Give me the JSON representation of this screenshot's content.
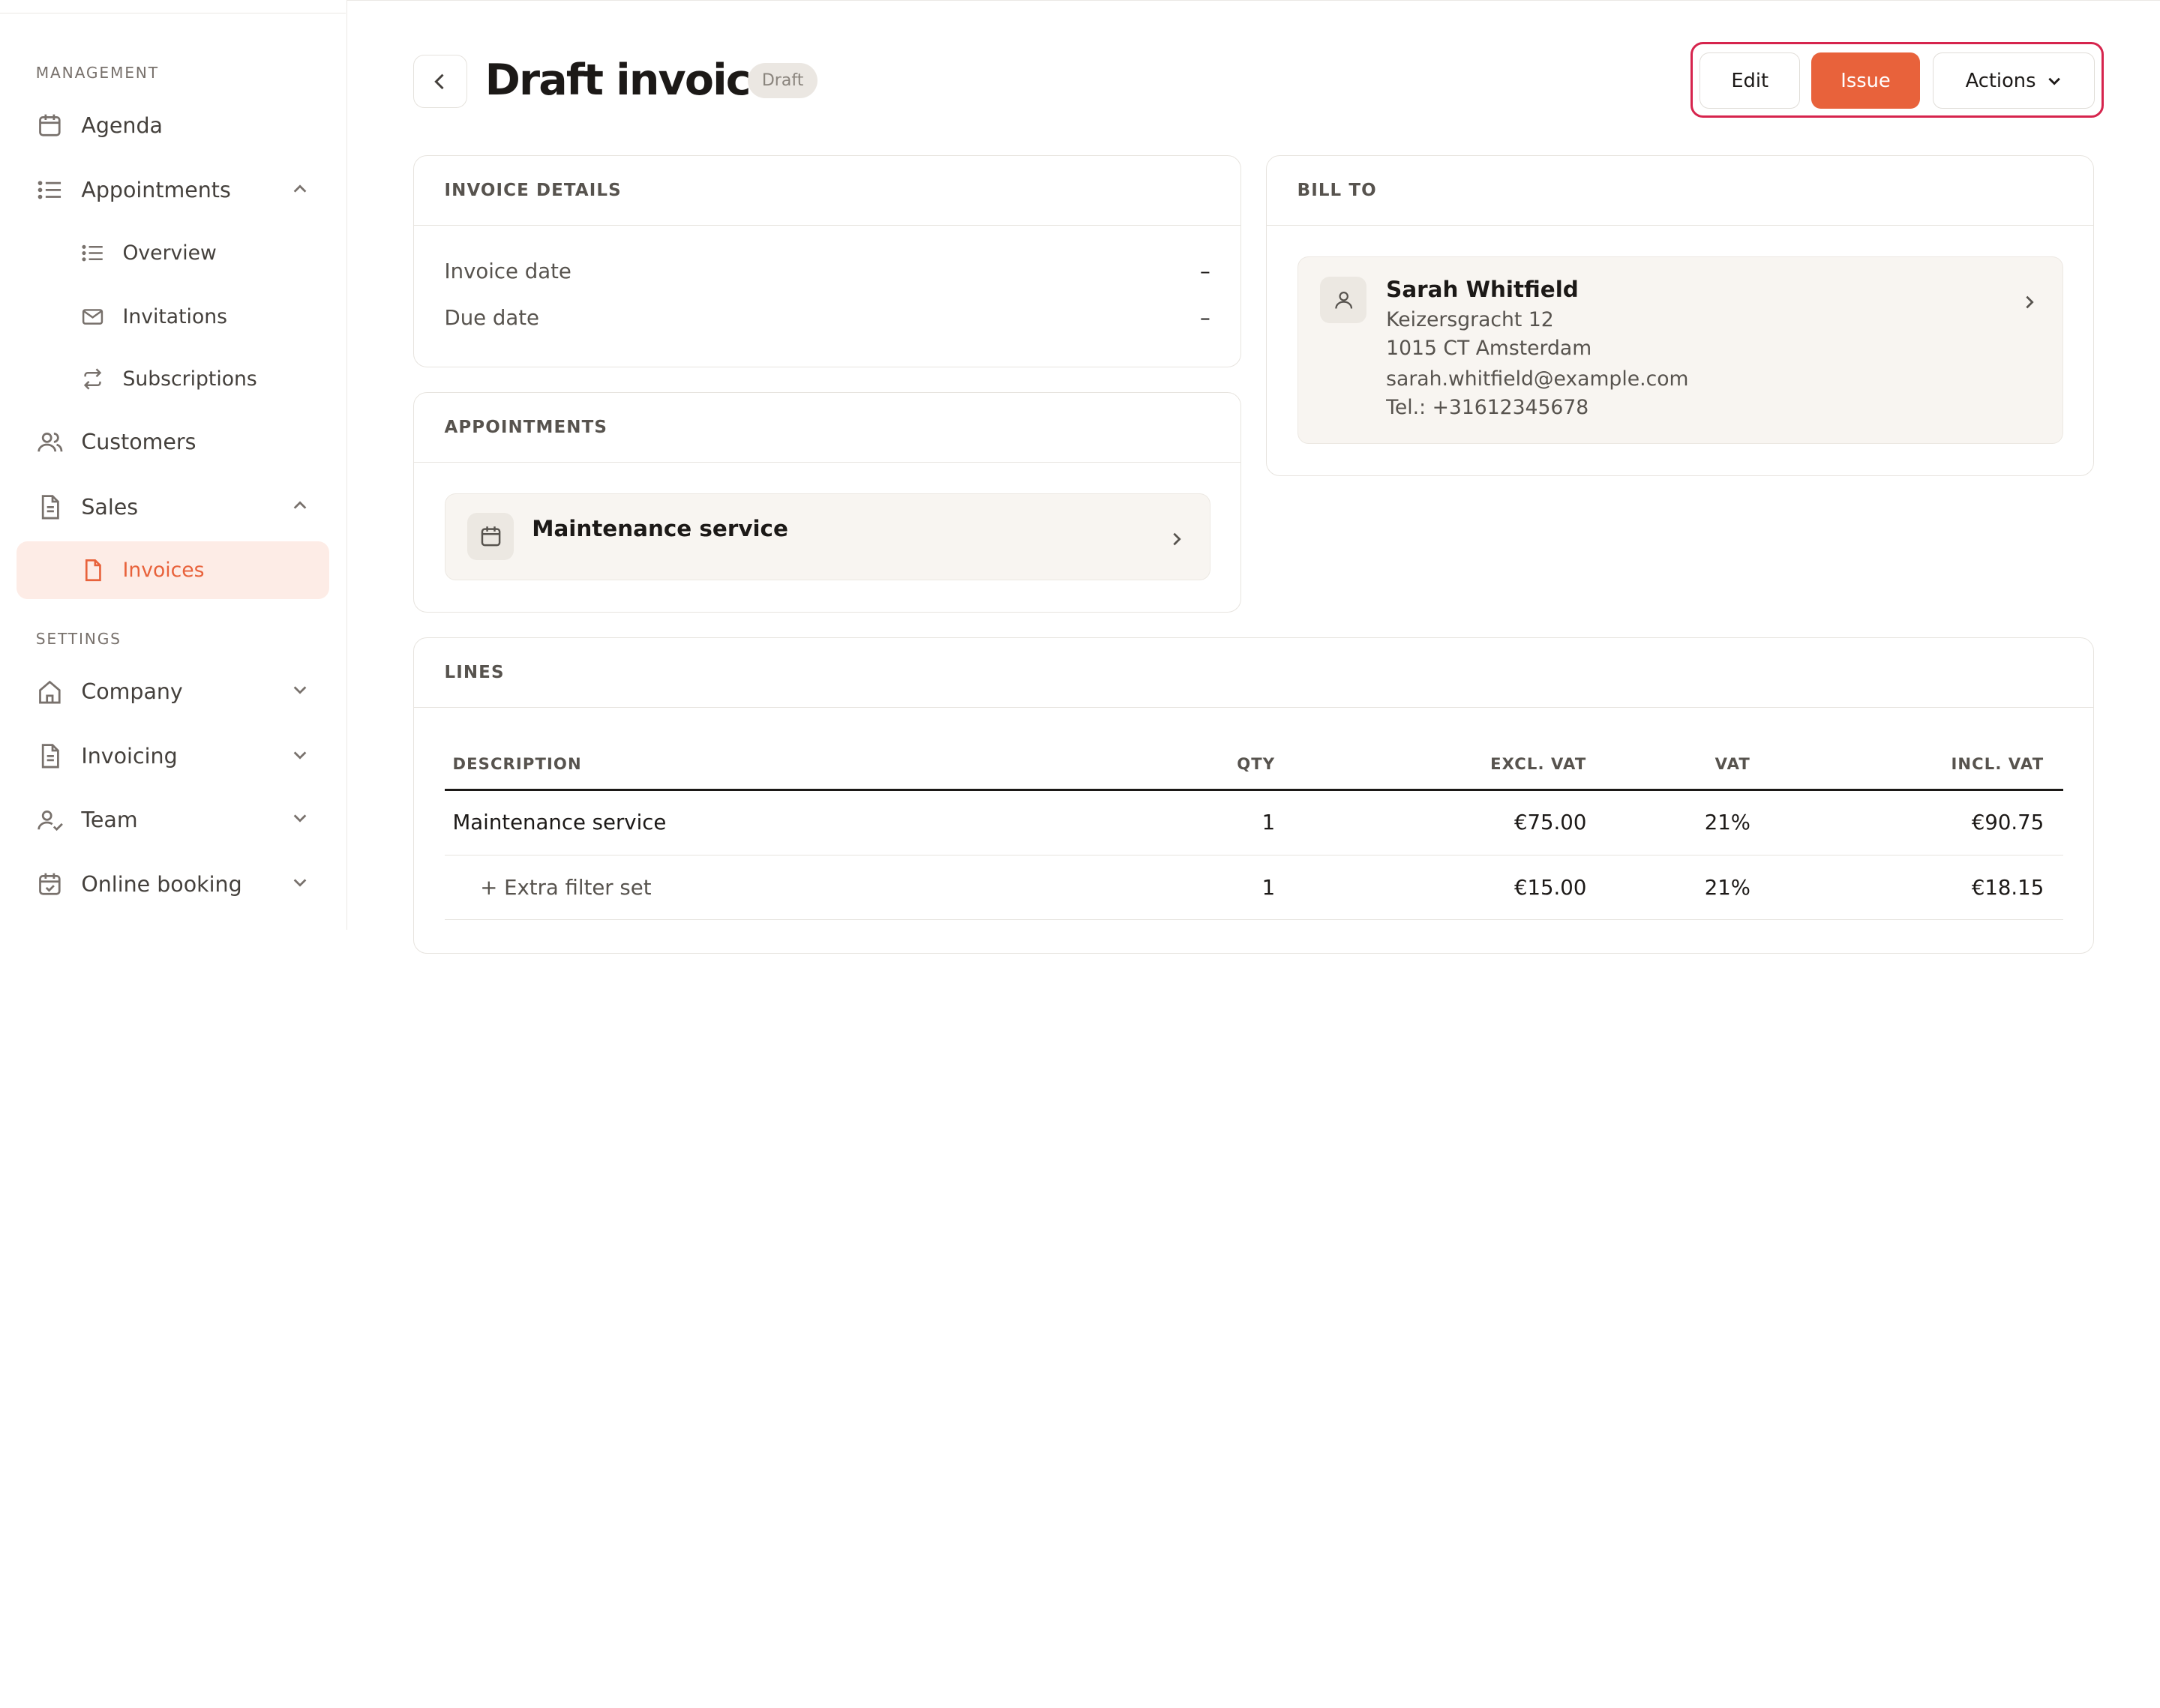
{
  "sidebar": {
    "section_management": "MANAGEMENT",
    "section_settings": "SETTINGS",
    "items": {
      "agenda": "Agenda",
      "appointments": "Appointments",
      "overview": "Overview",
      "invitations": "Invitations",
      "subscriptions": "Subscriptions",
      "customers": "Customers",
      "sales": "Sales",
      "invoices": "Invoices",
      "company": "Company",
      "invoicing": "Invoicing",
      "team": "Team",
      "online_booking": "Online booking"
    }
  },
  "header": {
    "title": "Draft invoice",
    "status": "Draft",
    "edit_label": "Edit",
    "issue_label": "Issue",
    "actions_label": "Actions"
  },
  "invoice_details": {
    "heading": "INVOICE DETAILS",
    "invoice_date_label": "Invoice date",
    "invoice_date_value": "–",
    "due_date_label": "Due date",
    "due_date_value": "–"
  },
  "appointments": {
    "heading": "APPOINTMENTS",
    "item_name": "Maintenance service"
  },
  "bill_to": {
    "heading": "BILL TO",
    "name": "Sarah Whitfield",
    "address1": "Keizersgracht 12",
    "address2": "1015 CT Amsterdam",
    "email": "sarah.whitfield@example.com",
    "phone": "Tel.: +31612345678"
  },
  "lines": {
    "heading": "LINES",
    "columns": {
      "description": "DESCRIPTION",
      "qty": "QTY",
      "excl_vat": "EXCL. VAT",
      "vat": "VAT",
      "incl_vat": "INCL. VAT"
    },
    "rows": [
      {
        "description": "Maintenance service",
        "qty": "1",
        "excl_vat": "€75.00",
        "vat": "21%",
        "incl_vat": "€90.75"
      },
      {
        "description": "+ Extra filter set",
        "qty": "1",
        "excl_vat": "€15.00",
        "vat": "21%",
        "incl_vat": "€18.15"
      }
    ]
  },
  "colors": {
    "accent": "#e8623b",
    "focus_ring": "#d6244d",
    "active_nav_bg": "#fdece6"
  }
}
